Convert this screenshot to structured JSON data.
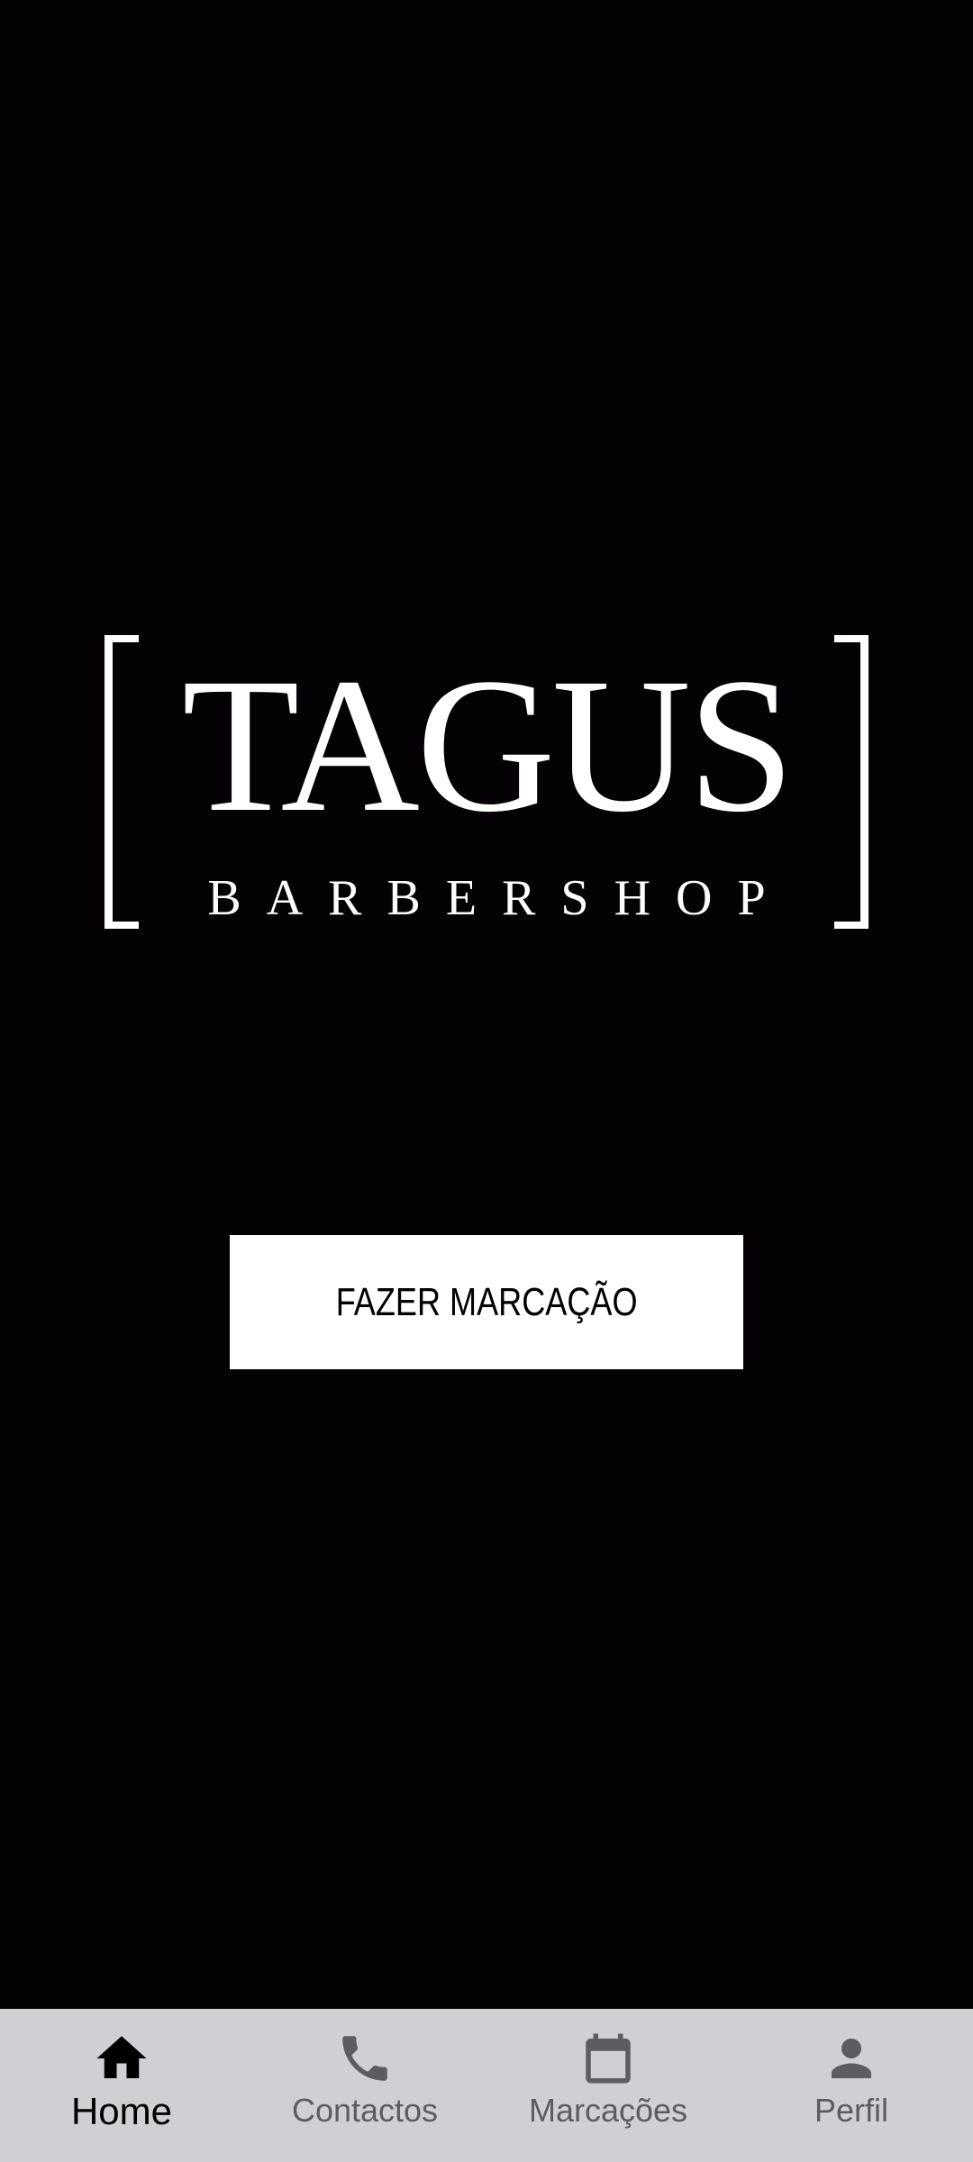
{
  "logo": {
    "title": "TAGUS",
    "subtitle": "BARBERSHOP"
  },
  "cta": {
    "label": "FAZER MARCAÇÃO"
  },
  "bottom_nav": {
    "active": "home",
    "items": [
      {
        "id": "home",
        "label": "Home",
        "icon": "home-icon"
      },
      {
        "id": "contactos",
        "label": "Contactos",
        "icon": "phone-icon"
      },
      {
        "id": "marcacoes",
        "label": "Marcações",
        "icon": "calendar-icon"
      },
      {
        "id": "perfil",
        "label": "Perfil",
        "icon": "person-icon"
      }
    ]
  },
  "colors": {
    "background": "#040205",
    "accent": "#ffffff",
    "nav_background": "#d1cfd3",
    "nav_inactive": "#5e5c61",
    "nav_active": "#000000"
  }
}
